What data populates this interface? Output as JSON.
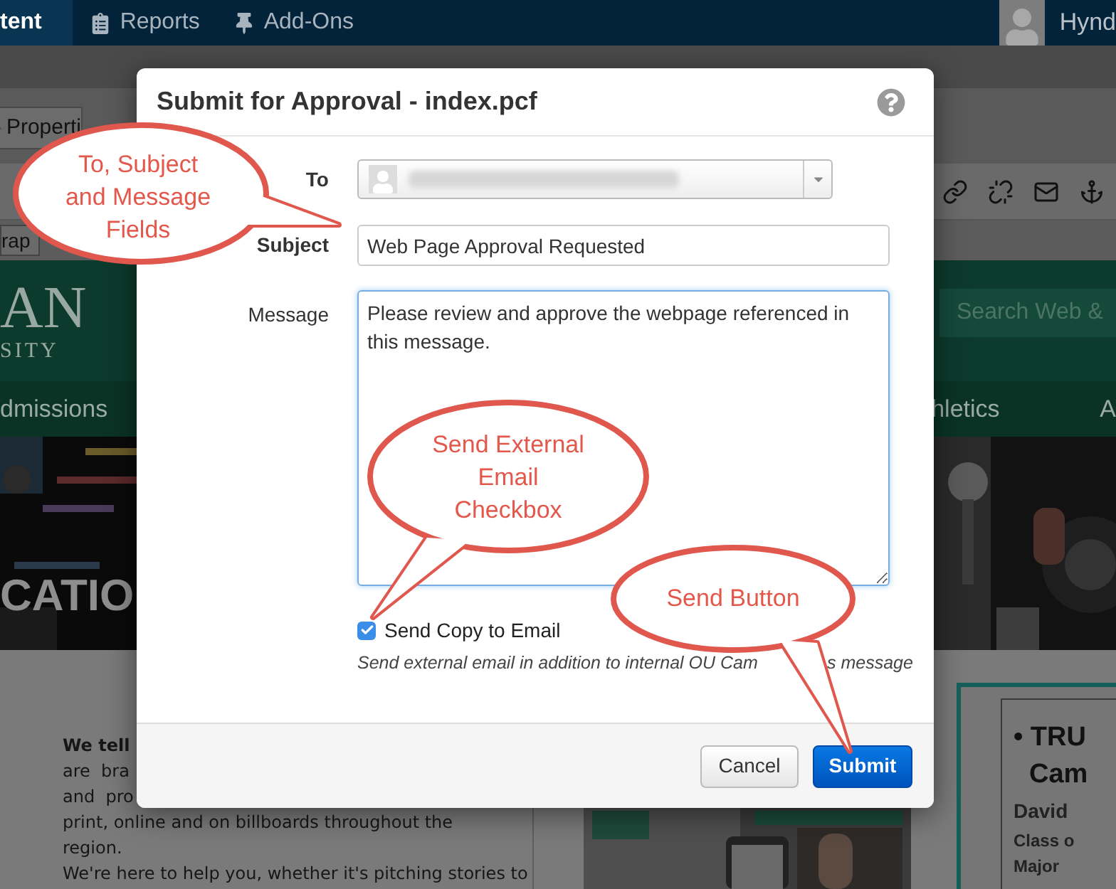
{
  "top_nav": {
    "items": [
      {
        "label": "tent",
        "selected": true
      },
      {
        "label": "Reports",
        "selected": false
      },
      {
        "label": "Add-Ons",
        "selected": false
      }
    ],
    "user": "Hynd"
  },
  "editor": {
    "tab": "Properti",
    "format_dropdown": "rap"
  },
  "site_header": {
    "logo_line_1": "AN",
    "logo_line_2": "SITY",
    "search": {
      "placeholder": "Search Web &"
    }
  },
  "site_nav": [
    "dmissions",
    "hletics",
    "A"
  ],
  "banner": {
    "title": "CATIO"
  },
  "content": {
    "lines": [
      {
        "text": "We tell",
        "bold": true
      },
      {
        "text": "are  bra",
        "bold": false
      },
      {
        "text": "and  pro",
        "bold": false
      },
      {
        "text": "print, online and on billboards throughout the",
        "bold": false
      },
      {
        "text": "region.",
        "bold": false
      },
      {
        "text": "We're here to help you, whether it's pitching stories to",
        "bold": false
      }
    ],
    "card": [
      {
        "text": "• TRU",
        "kind": "heading"
      },
      {
        "text": "Cam",
        "kind": "heading"
      },
      {
        "text": "David",
        "kind": "name"
      },
      {
        "text": "Class o",
        "kind": "meta"
      },
      {
        "text": "Major",
        "kind": "meta"
      }
    ]
  },
  "dialog": {
    "title": "Submit for Approval - index.pcf",
    "to_label": "To",
    "subject_label": "Subject",
    "subject_value": "Web Page Approval Requested",
    "message_label": "Message",
    "message_value": "Please review and approve the webpage referenced in this message.",
    "send_copy": {
      "label": "Send Copy to Email",
      "checked": true,
      "help": [
        "Send external email in addition to internal OU Cam",
        "s message"
      ]
    },
    "buttons": [
      {
        "label": "Cancel",
        "kind": "secondary"
      },
      {
        "label": "Submit",
        "kind": "primary"
      }
    ]
  },
  "callouts": [
    {
      "text": "To, Subject\nand Message\nFields"
    },
    {
      "text": "Send External\nEmail\nCheckbox"
    },
    {
      "text": "Send Button"
    }
  ]
}
